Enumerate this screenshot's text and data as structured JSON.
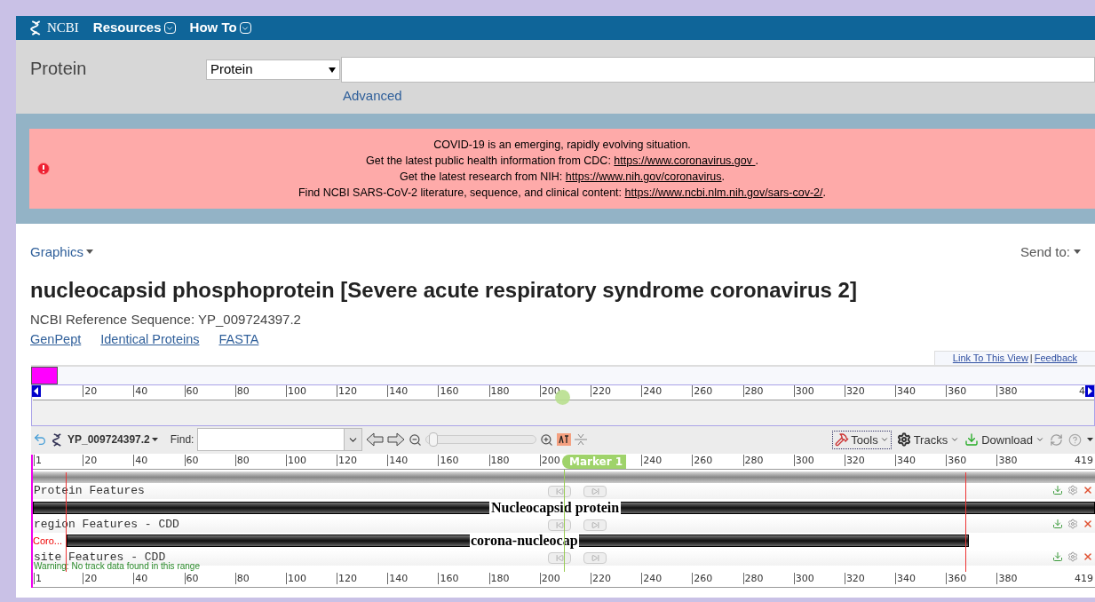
{
  "header": {
    "logo": "NCBI",
    "menus": [
      "Resources",
      "How To"
    ]
  },
  "search": {
    "db_label": "Protein",
    "select": "Protein",
    "advanced": "Advanced"
  },
  "alert": {
    "lines": [
      {
        "text": "COVID-19 is an emerging, rapidly evolving situation."
      },
      {
        "text": "Get the latest public health information from CDC: ",
        "link": "https://www.coronavirus.gov ",
        "after": "."
      },
      {
        "text": "Get the latest research from NIH: ",
        "link": "https://www.nih.gov/coronavirus",
        "after": "."
      },
      {
        "text": "Find NCBI SARS-CoV-2 literature, sequence, and clinical content: ",
        "link": "https://www.ncbi.nlm.nih.gov/sars-cov-2/",
        "after": "."
      }
    ]
  },
  "graphics": "Graphics",
  "send_to": "Send to:",
  "title": "nucleocapsid phosphoprotein [Severe acute respiratory syndrome coronavirus 2]",
  "refseq": "NCBI Reference Sequence: YP_009724397.2",
  "links": [
    "GenPept",
    "Identical Proteins",
    "FASTA"
  ],
  "viewer": {
    "top_links": [
      "Link To This View",
      "Feedback"
    ],
    "link_separator": "|",
    "overview_ruler": {
      "ticks": [
        "20",
        "40",
        "60",
        "80",
        "100",
        "120",
        "140",
        "160",
        "180",
        "200",
        "220",
        "240",
        "260",
        "280",
        "300",
        "320",
        "340",
        "360",
        "380"
      ],
      "end": "4"
    },
    "toolbar": {
      "accession": "YP_009724397.2",
      "find_label": "Find:",
      "zoom_slider": {
        "level": 0.02
      },
      "tools": "Tools",
      "tracks": "Tracks",
      "download": "Download"
    },
    "marker": "Marker 1",
    "ruler": {
      "start": "1",
      "ticks": [
        "20",
        "40",
        "60",
        "80",
        "100",
        "120",
        "140",
        "160",
        "180",
        "200"
      ],
      "ticks_after_marker": [
        "240",
        "260",
        "280",
        "300",
        "320",
        "340",
        "360",
        "380"
      ],
      "end": "419"
    },
    "tracks": [
      {
        "title": "Protein Features",
        "feature": "Nucleocapsid protein",
        "kind": "full"
      },
      {
        "title": "region Features - CDD",
        "feature": "corona-nucleocap",
        "side_label": "Coro...",
        "kind": "range"
      },
      {
        "title": "site Features - CDD",
        "warning": "Warning: No track data found in this range",
        "kind": "empty"
      }
    ],
    "bottom_ruler": {
      "start": "1",
      "ticks": [
        "20",
        "40",
        "60",
        "80",
        "100",
        "120",
        "140",
        "160",
        "180",
        "200",
        "220",
        "240",
        "260",
        "280",
        "300",
        "320",
        "340",
        "360",
        "380"
      ],
      "end": "419"
    }
  }
}
